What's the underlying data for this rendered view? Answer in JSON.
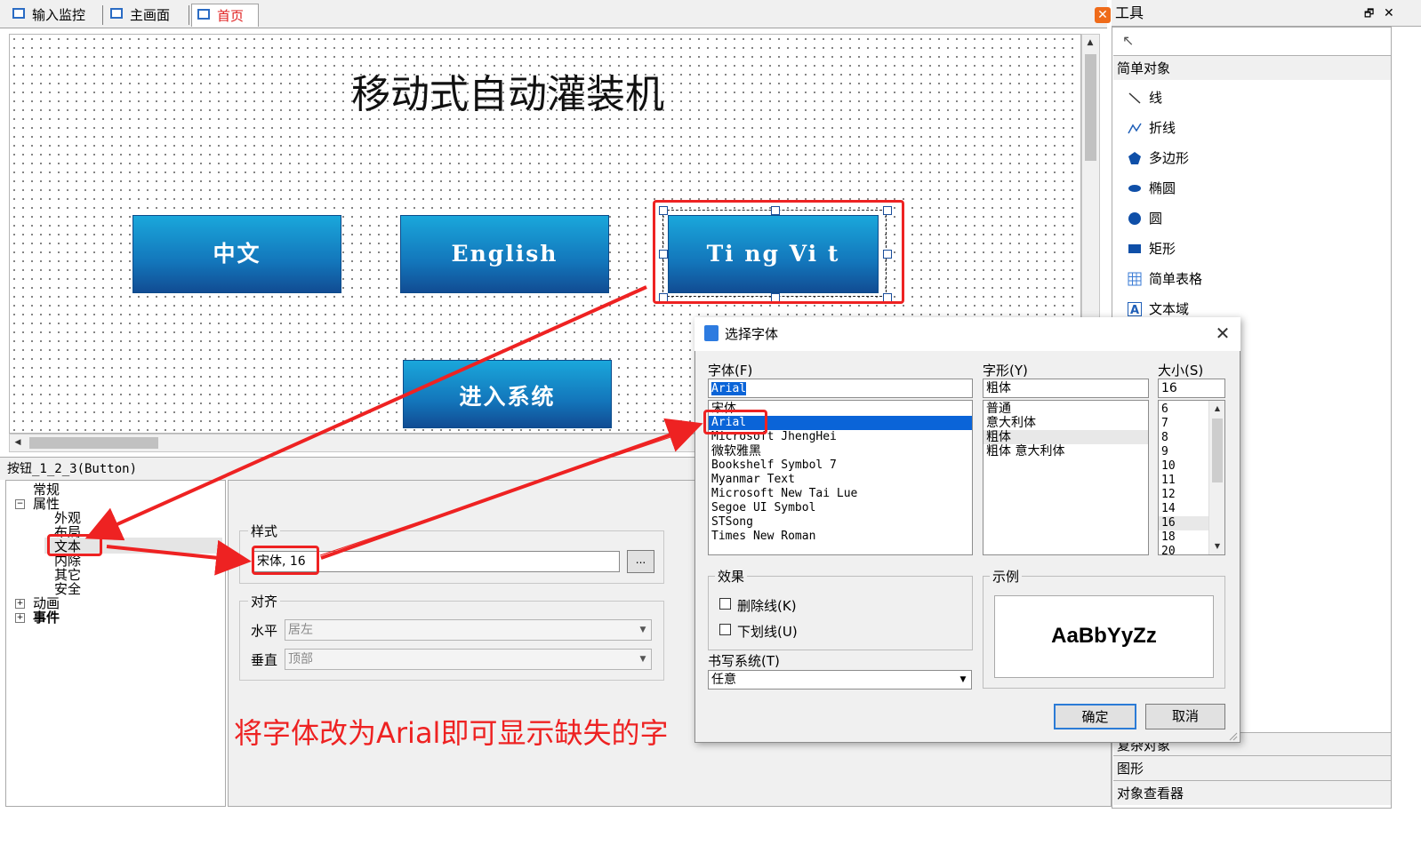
{
  "tabs": [
    {
      "label": "输入监控",
      "active": false
    },
    {
      "label": "主画面",
      "active": false
    },
    {
      "label": "首页",
      "active": true
    }
  ],
  "canvas": {
    "title": "移动式自动灌装机",
    "buttons": {
      "chinese": "中文",
      "english": "English",
      "vietnamese": "Ti ng Vi t",
      "enter": "进入系统"
    }
  },
  "tools": {
    "header": "工具",
    "category_simple": "简单对象",
    "items": [
      "线",
      "折线",
      "多边形",
      "椭圆",
      "圆",
      "矩形",
      "简单表格",
      "文本域"
    ],
    "category_complex": "复杂对象",
    "category_graphics": "图形",
    "category_inspector": "对象查看器"
  },
  "properties": {
    "header": "按钮_1_2_3(Button)",
    "tree": {
      "general": "常规",
      "attributes": "属性",
      "appearance": "外观",
      "layout": "布局",
      "text": "文本",
      "inner_margin": "内除",
      "other": "其它",
      "security": "安全",
      "animation": "动画",
      "events": "事件"
    },
    "style_label": "样式",
    "style_value": "宋体, 16",
    "browse_label": "...",
    "align_label": "对齐",
    "horizontal_label": "水平",
    "horizontal_value": "居左",
    "vertical_label": "垂直",
    "vertical_value": "顶部"
  },
  "annotation": "将字体改为Arial即可显示缺失的字",
  "font_dialog": {
    "title": "选择字体",
    "font_label": "字体(F)",
    "font_value": "Arial",
    "fonts": [
      "宋体",
      "Arial",
      "Microsoft JhengHei",
      "微软雅黑",
      "Bookshelf Symbol 7",
      "Myanmar Text",
      "Microsoft New Tai Lue",
      "Segoe UI Symbol",
      "STSong",
      "Times New Roman"
    ],
    "style_label": "字形(Y)",
    "style_value": "粗体",
    "styles": [
      "普通",
      "意大利体",
      "粗体",
      "粗体 意大利体"
    ],
    "size_label": "大小(S)",
    "size_value": "16",
    "sizes": [
      "6",
      "7",
      "8",
      "9",
      "10",
      "11",
      "12",
      "14",
      "16",
      "18",
      "20"
    ],
    "effects_label": "效果",
    "strikeout_label": "删除线(K)",
    "underline_label": "下划线(U)",
    "sample_label": "示例",
    "sample_text": "AaBbYyZz",
    "script_label": "书写系统(T)",
    "script_value": "任意",
    "ok_label": "确定",
    "cancel_label": "取消"
  }
}
